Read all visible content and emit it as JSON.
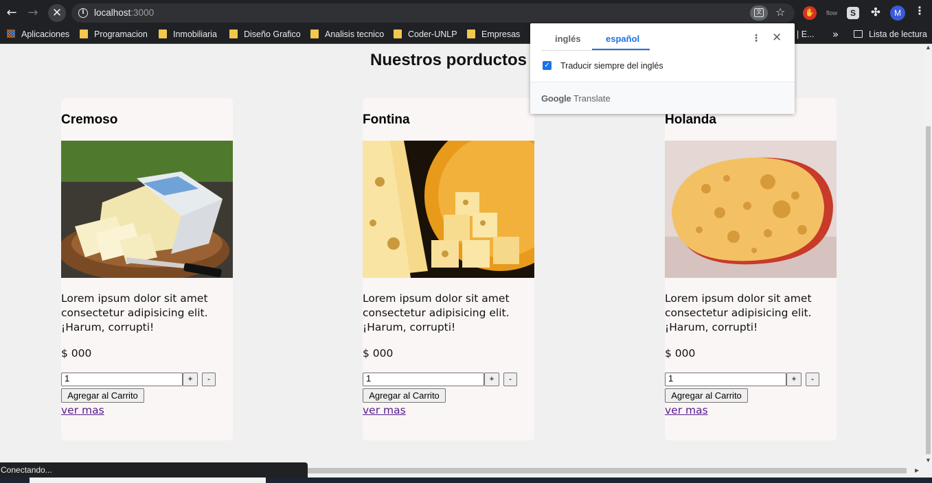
{
  "browser": {
    "url_host": "localhost",
    "url_port": ":3000",
    "nav": {
      "back": "←",
      "forward": "→",
      "stop": "✕"
    },
    "icons": {
      "info": "i",
      "translate": "文",
      "star": "☆",
      "ext_red": "✋",
      "ext_flow": "flow",
      "ext_s": "S",
      "puzzle": "✣",
      "menu": "⋮",
      "chevron": "»"
    },
    "avatar_letter": "M"
  },
  "bookmarks": {
    "apps": "Aplicaciones",
    "items": [
      "Programacion",
      "Inmobiliaria",
      "Diseño Grafico",
      "Analisis tecnico",
      "Coder-UNLP",
      "Empresas"
    ],
    "overflow_partial": "| E...",
    "reading_list": "Lista de lectura"
  },
  "translate_popup": {
    "tab_source": "inglés",
    "tab_target": "español",
    "menu": "⋮",
    "close": "✕",
    "checkbox_mark": "✓",
    "always_translate": "Traducir siempre del inglés",
    "brand_google": "Google",
    "brand_translate": "Translate"
  },
  "page": {
    "title": "Nuestros porductos",
    "products": [
      {
        "name": "Cremoso",
        "desc": "Lorem ipsum dolor sit amet consectetur adipisicing elit. ¡Harum, corrupti!",
        "price": "$ 000",
        "qty": "1",
        "plus": "+",
        "minus": "-",
        "add": "Agregar al Carrito",
        "more": "ver mas"
      },
      {
        "name": "Fontina",
        "desc": "Lorem ipsum dolor sit amet consectetur adipisicing elit. ¡Harum, corrupti!",
        "price": "$ 000",
        "qty": "1",
        "plus": "+",
        "minus": "-",
        "add": "Agregar al Carrito",
        "more": "ver mas"
      },
      {
        "name": "Holanda",
        "desc": "Lorem ipsum dolor sit amet consectetur adipisicing elit. ¡Harum, corrupti!",
        "price": "$ 000",
        "qty": "1",
        "plus": "+",
        "minus": "-",
        "add": "Agregar al Carrito",
        "more": "ver mas"
      }
    ]
  },
  "status_text": "Conectando...",
  "colors": {
    "chrome_dark": "#202124",
    "accent_blue": "#1a73e8",
    "card_bg": "#faf6f5",
    "visited_link": "#551a8b"
  }
}
